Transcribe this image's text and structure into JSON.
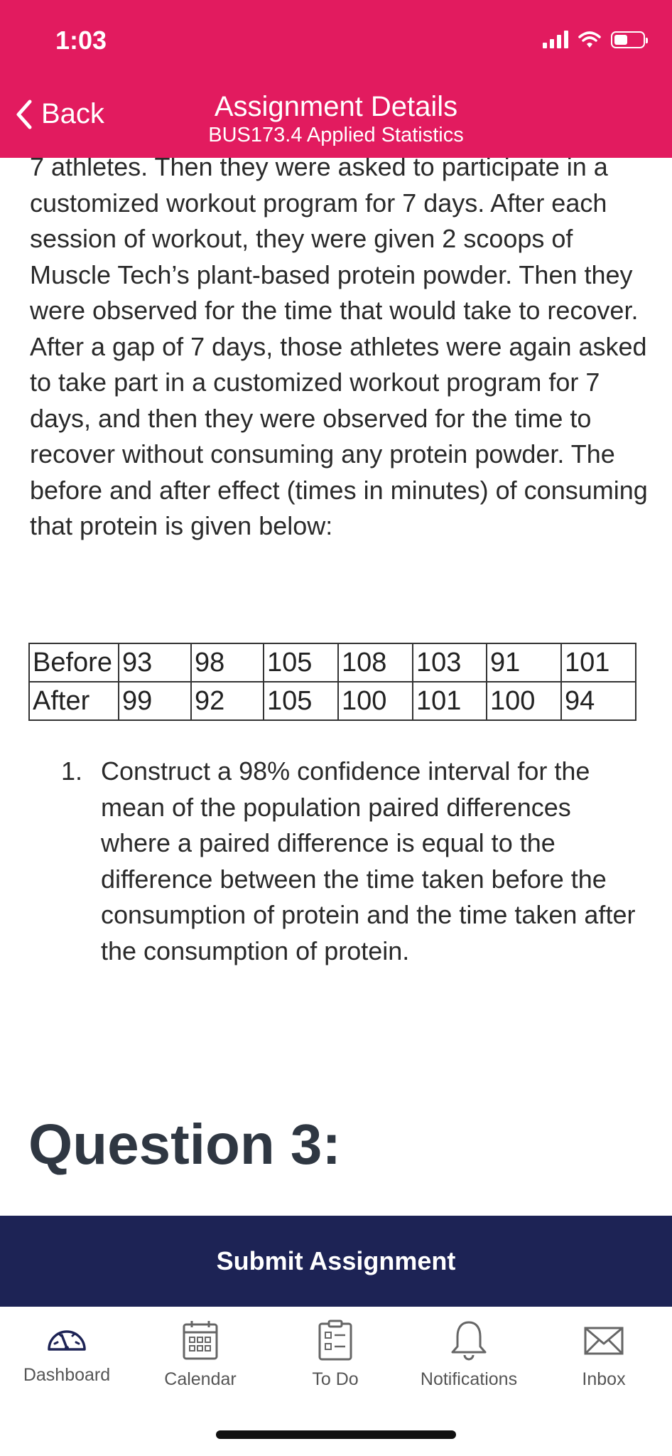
{
  "status_bar": {
    "time": "1:03"
  },
  "header": {
    "back_label": "Back",
    "title": "Assignment Details",
    "subtitle": "BUS173.4 Applied Statistics"
  },
  "content": {
    "paragraph": "7 athletes. Then they were asked to participate in a customized workout program for 7 days. After each session of workout, they were given 2 scoops of Muscle Tech’s plant-based protein powder. Then they were observed for the time that would take to recover. After a gap of 7 days, those athletes were again asked to take part in a customized workout program for 7 days, and then they were observed for the time to recover without consuming any protein powder. The before and after effect (times in minutes) of consuming that protein is given below:"
  },
  "table": {
    "rows": [
      {
        "label": "Before",
        "values": [
          "93",
          "98",
          "105",
          "108",
          "103",
          "91",
          "101"
        ]
      },
      {
        "label": "After",
        "values": [
          "99",
          "92",
          "105",
          "100",
          "101",
          "100",
          "94"
        ]
      }
    ]
  },
  "questions": [
    {
      "number": "1.",
      "text": "Construct a 98% confidence interval for the mean of the population paired differences where a paired difference is equal to the difference between the time taken before the consumption of protein and the time taken after the consumption of protein."
    }
  ],
  "section_heading": "Question 3:",
  "submit_label": "Submit Assignment",
  "tabs": [
    {
      "label": "Dashboard",
      "icon": "dashboard-icon"
    },
    {
      "label": "Calendar",
      "icon": "calendar-icon"
    },
    {
      "label": "To Do",
      "icon": "todo-icon"
    },
    {
      "label": "Notifications",
      "icon": "bell-icon"
    },
    {
      "label": "Inbox",
      "icon": "mail-icon"
    }
  ],
  "colors": {
    "header": "#e21b5f",
    "submit": "#1d2355",
    "heading": "#2f3742"
  }
}
